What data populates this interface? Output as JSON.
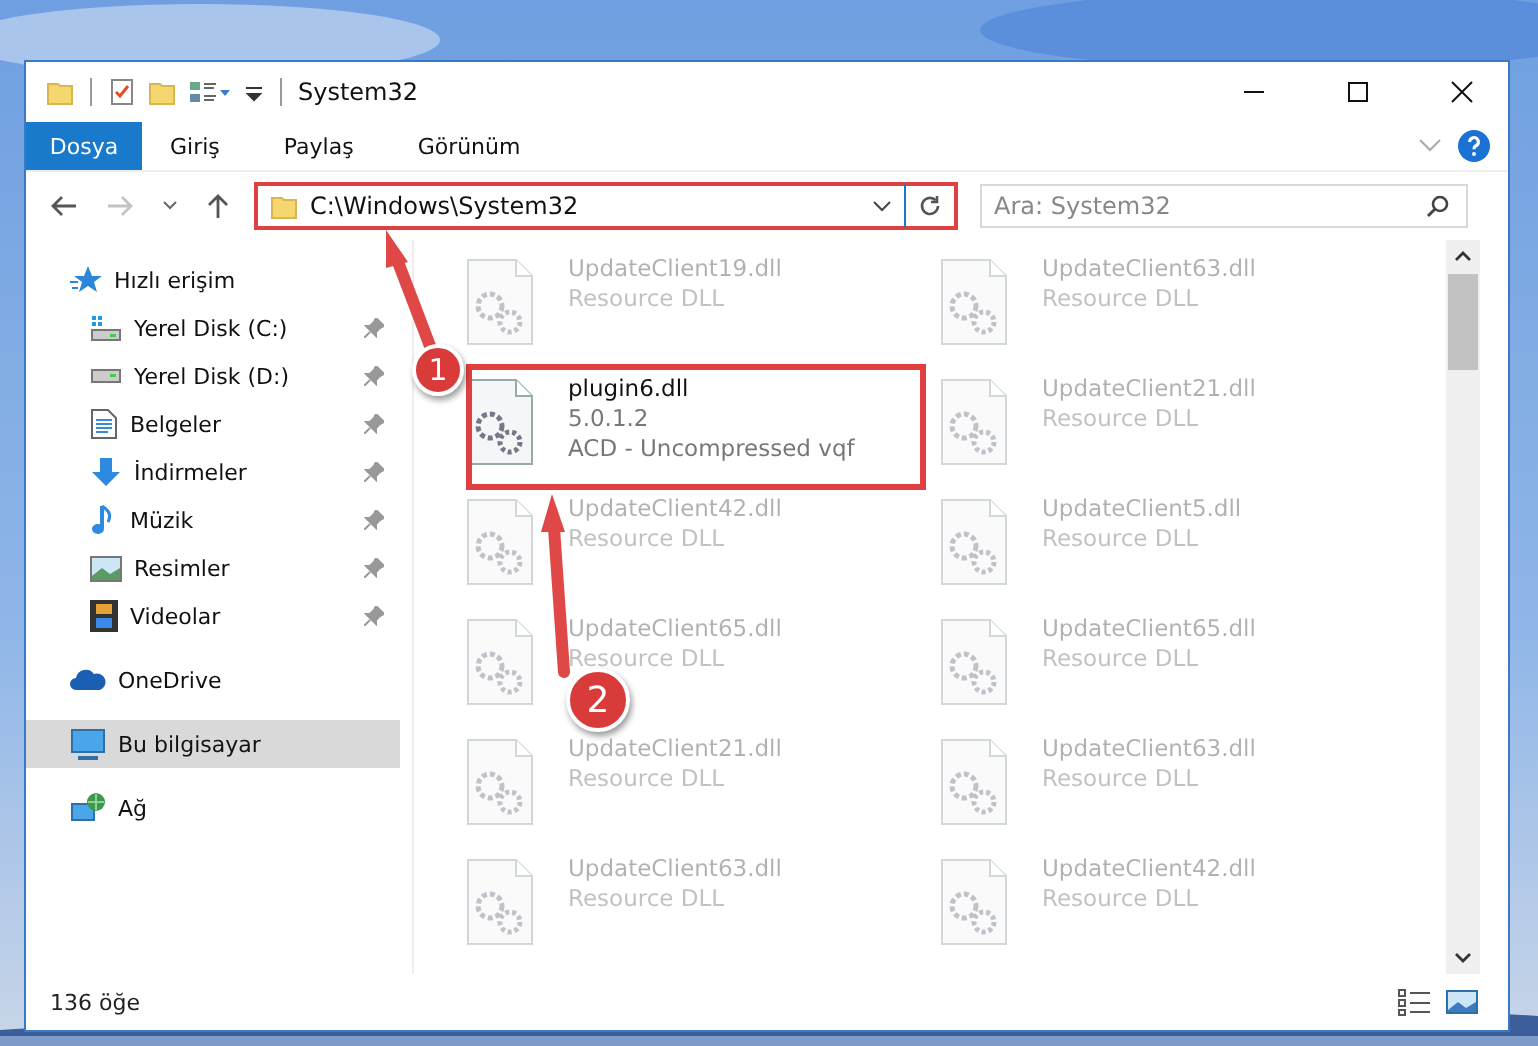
{
  "window": {
    "title": "System32"
  },
  "ribbon_tabs": [
    {
      "label": "Dosya",
      "kind": "file"
    },
    {
      "label": "Giriş",
      "kind": "tab"
    },
    {
      "label": "Paylaş",
      "kind": "tab"
    },
    {
      "label": "Görünüm",
      "kind": "tab"
    }
  ],
  "address_bar": {
    "path": "C:\\Windows\\System32"
  },
  "search": {
    "placeholder": "Ara: System32"
  },
  "sidebar": {
    "items": [
      {
        "label": "Hızlı erişim",
        "selected": false,
        "children": [
          {
            "label": "Yerel Disk (C:)",
            "pinned": true,
            "selected": false
          },
          {
            "label": "Yerel Disk (D:)",
            "pinned": true,
            "selected": false
          },
          {
            "label": "Belgeler",
            "pinned": true,
            "selected": false
          },
          {
            "label": "İndirmeler",
            "pinned": true,
            "selected": false
          },
          {
            "label": "Müzik",
            "pinned": true,
            "selected": false
          },
          {
            "label": "Resimler",
            "pinned": true,
            "selected": false
          },
          {
            "label": "Videolar",
            "pinned": true,
            "selected": false
          }
        ]
      },
      {
        "label": "OneDrive",
        "selected": false
      },
      {
        "label": "Bu bilgisayar",
        "selected": true
      },
      {
        "label": "Ağ",
        "selected": false
      }
    ]
  },
  "files": [
    {
      "name": "UpdateClient19.dll",
      "details": [
        "Resource DLL"
      ],
      "faded": true
    },
    {
      "name": "UpdateClient63.dll",
      "details": [
        "Resource DLL"
      ],
      "faded": true
    },
    {
      "name": "plugin6.dll",
      "details": [
        "5.0.1.2",
        "ACD - Uncompressed vqf"
      ],
      "faded": false
    },
    {
      "name": "UpdateClient21.dll",
      "details": [
        "Resource DLL"
      ],
      "faded": true
    },
    {
      "name": "UpdateClient42.dll",
      "details": [
        "Resource DLL"
      ],
      "faded": true
    },
    {
      "name": "UpdateClient5.dll",
      "details": [
        "Resource DLL"
      ],
      "faded": true
    },
    {
      "name": "UpdateClient65.dll",
      "details": [
        "Resource DLL"
      ],
      "faded": true
    },
    {
      "name": "UpdateClient65.dll",
      "details": [
        "Resource DLL"
      ],
      "faded": true
    },
    {
      "name": "UpdateClient21.dll",
      "details": [
        "Resource DLL"
      ],
      "faded": true
    },
    {
      "name": "UpdateClient63.dll",
      "details": [
        "Resource DLL"
      ],
      "faded": true
    },
    {
      "name": "UpdateClient63.dll",
      "details": [
        "Resource DLL"
      ],
      "faded": true
    },
    {
      "name": "UpdateClient42.dll",
      "details": [
        "Resource DLL"
      ],
      "faded": true
    }
  ],
  "status_bar": {
    "item_count": "136 öğe"
  },
  "annotations": {
    "markers": [
      {
        "label": "1"
      },
      {
        "label": "2"
      }
    ]
  }
}
